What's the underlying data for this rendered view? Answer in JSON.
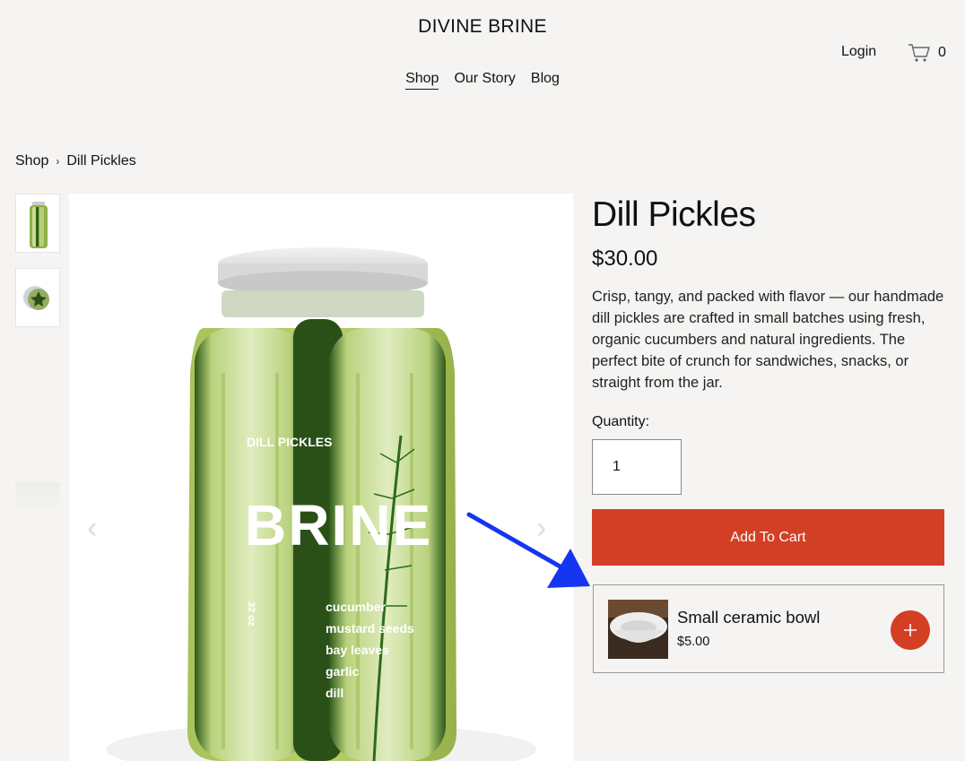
{
  "header": {
    "brand": "DIVINE BRINE",
    "nav": [
      "Shop",
      "Our Story",
      "Blog"
    ],
    "login": "Login",
    "cart_count": "0",
    "cart_icon": "shopping-cart-icon"
  },
  "breadcrumb": {
    "shop": "Shop",
    "separator": "›",
    "current": "Dill Pickles"
  },
  "product_image": {
    "jar_label_small": "DILL PICKLES",
    "jar_label_big": "BRINE",
    "jar_size": "32 oz",
    "ingredients": [
      "cucumber",
      "mustard seeds",
      "bay leaves",
      "garlic",
      "dill"
    ]
  },
  "product": {
    "title": "Dill Pickles",
    "price": "$30.00",
    "description": "Crisp, tangy, and packed with flavor — our handmade dill pickles are crafted in small batches using fresh, organic cucumbers and natural ingredients. The perfect bite of crunch for sandwiches, snacks, or straight from the jar.",
    "quantity_label": "Quantity:",
    "quantity_value": "1",
    "add_to_cart": "Add To Cart"
  },
  "upsell": {
    "name": "Small ceramic bowl",
    "price": "$5.00"
  },
  "colors": {
    "accent": "#d33f24",
    "background": "#f5f4f2",
    "annotation_arrow": "#1535f0"
  }
}
